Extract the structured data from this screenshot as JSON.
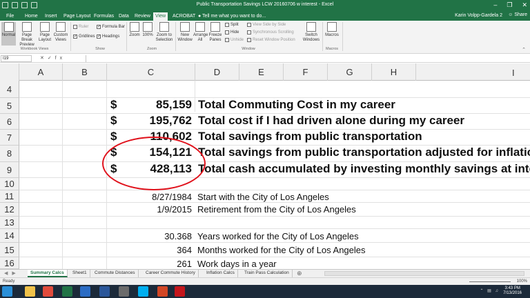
{
  "window": {
    "title": "Public Transportation Savings LCW 20160706 w interest - Excel",
    "controls": [
      "–",
      "❐",
      "✕"
    ]
  },
  "tabs": [
    {
      "label": "File",
      "active": false
    },
    {
      "label": "Home",
      "active": false
    },
    {
      "label": "Insert",
      "active": false
    },
    {
      "label": "Page Layout",
      "active": false
    },
    {
      "label": "Formulas",
      "active": false
    },
    {
      "label": "Data",
      "active": false
    },
    {
      "label": "Review",
      "active": false
    },
    {
      "label": "View",
      "active": true
    },
    {
      "label": "ACROBAT",
      "active": false
    }
  ],
  "tell_me": "Tell me what you want to do...",
  "user": "Karin Volpp-Gardela 2",
  "share": "Share",
  "ribbon": {
    "workbook_views": {
      "label": "Workbook Views",
      "normal": "Normal",
      "page_break": "Page Break Preview",
      "page_layout": "Page Layout",
      "custom_views": "Custom Views"
    },
    "show": {
      "label": "Show",
      "ruler": "Ruler",
      "gridlines": "Gridlines",
      "formula_bar": "Formula Bar",
      "headings": "Headings"
    },
    "zoom": {
      "label": "Zoom",
      "zoom": "Zoom",
      "hundred": "100%",
      "zoom_to_selection": "Zoom to Selection"
    },
    "window": {
      "label": "Window",
      "new_window": "New Window",
      "arrange_all": "Arrange All",
      "freeze_panes": "Freeze Panes",
      "split": "Split",
      "hide": "Hide",
      "unhide": "Unhide",
      "view_side_by_side": "View Side by Side",
      "sync_scrolling": "Synchronous Scrolling",
      "reset_position": "Reset Window Position",
      "switch_windows": "Switch Windows"
    },
    "macros": {
      "label": "Macros",
      "macros": "Macros"
    }
  },
  "formula_bar": {
    "name_box": "I19",
    "fx": "✕✓fx",
    "content": ""
  },
  "columns": [
    "A",
    "B",
    "C",
    "D",
    "E",
    "F",
    "G",
    "H",
    "I"
  ],
  "rows": [
    "4",
    "5",
    "6",
    "7",
    "8",
    "9",
    "10",
    "11",
    "12",
    "13",
    "14",
    "15",
    "16"
  ],
  "summary": [
    {
      "dollar": "$",
      "amount": "85,159",
      "label": "Total Commuting Cost in my career"
    },
    {
      "dollar": "$",
      "amount": "195,762",
      "label": "Total cost if I had driven alone during my career"
    },
    {
      "dollar": "$",
      "amount": "110,602",
      "label": "Total savings from public transportation"
    },
    {
      "dollar": "$",
      "amount": "154,121",
      "label": "Total savings from public transportation adjusted for inflatio"
    },
    {
      "dollar": "$",
      "amount": "428,113",
      "label": "Total cash accumulated by investing monthly savings at inter"
    }
  ],
  "details": [
    {
      "value": "8/27/1984",
      "label": "Start with the City of Los Angeles"
    },
    {
      "value": "1/9/2015",
      "label": "Retirement from the City of Los Angeles"
    },
    {
      "value": "30.368",
      "label": "Years worked for the City of Los Angeles"
    },
    {
      "value": "364",
      "label": "Months worked for the City of Los Angeles"
    },
    {
      "value": "261",
      "label": "Work days in a year"
    }
  ],
  "sheet_tabs": [
    {
      "label": "Summary Calcs",
      "active": true
    },
    {
      "label": "Sheet1",
      "active": false
    },
    {
      "label": "Commute Distances",
      "active": false
    },
    {
      "label": "Career Commute History",
      "active": false
    },
    {
      "label": "Inflation Calcs",
      "active": false
    },
    {
      "label": "Train Pass Calculation",
      "active": false
    }
  ],
  "status": {
    "ready": "Ready",
    "zoom": "100%"
  },
  "taskbar": {
    "time": "3:43 PM",
    "date": "7/13/2016",
    "icons": [
      "windows-start",
      "explorer",
      "chrome",
      "excel",
      "outlook",
      "word",
      "vpn",
      "skype",
      "powerpoint",
      "acrobat"
    ],
    "icon_colors": [
      "#2a8fd8",
      "#f0c24a",
      "#e14b3c",
      "#217346",
      "#2b6cc4",
      "#2b579a",
      "#6b6b6b",
      "#00aff0",
      "#d24726",
      "#c4161c"
    ]
  }
}
